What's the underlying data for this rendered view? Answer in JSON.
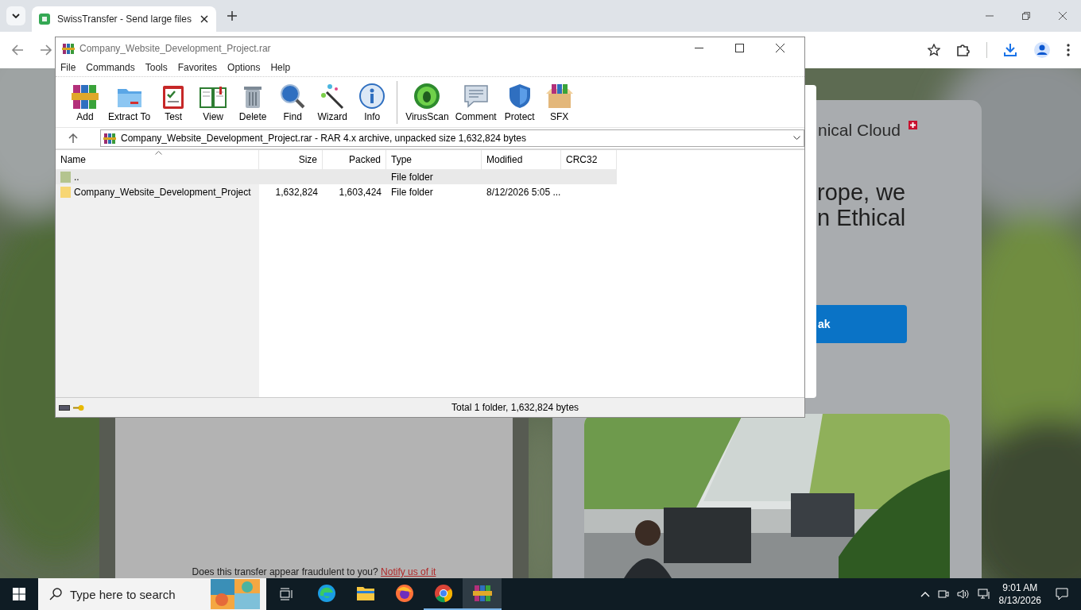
{
  "browser": {
    "tabs": [
      {
        "title": "SwissTransfer - Send large files",
        "selected": true
      }
    ]
  },
  "page": {
    "brand": "nical Cloud",
    "headline": [
      "rope, we",
      "n Ethical"
    ],
    "cta": "ak",
    "report": {
      "text": "Does this transfer appear fraudulent to you?",
      "link": "Notify us of it"
    }
  },
  "winrar": {
    "title": "Company_Website_Development_Project.rar",
    "menu": [
      "File",
      "Commands",
      "Tools",
      "Favorites",
      "Options",
      "Help"
    ],
    "toolbar": [
      {
        "label": "Add"
      },
      {
        "label": "Extract To"
      },
      {
        "label": "Test"
      },
      {
        "label": "View"
      },
      {
        "label": "Delete"
      },
      {
        "label": "Find"
      },
      {
        "label": "Wizard"
      },
      {
        "label": "Info"
      },
      {
        "label": "VirusScan"
      },
      {
        "label": "Comment"
      },
      {
        "label": "Protect"
      },
      {
        "label": "SFX"
      }
    ],
    "path": "Company_Website_Development_Project.rar - RAR 4.x archive, unpacked size 1,632,824 bytes",
    "columns": [
      "Name",
      "Size",
      "Packed",
      "Type",
      "Modified",
      "CRC32"
    ],
    "rows": [
      {
        "kind": "parent",
        "name": "..",
        "type": "File folder",
        "selected": true
      },
      {
        "kind": "folder",
        "name": "Company_Website_Development_Project",
        "size": "1,632,824",
        "packed": "1,603,424",
        "type": "File folder",
        "modified": "8/12/2026 5:05 ...",
        "selected": false
      }
    ],
    "status": "Total 1 folder, 1,632,824 bytes"
  },
  "taskbar": {
    "search_placeholder": "Type here to search",
    "apps": [
      {
        "running": false,
        "selected": false
      },
      {
        "running": false,
        "selected": false
      },
      {
        "running": false,
        "selected": false
      },
      {
        "running": true,
        "selected": false
      },
      {
        "running": true,
        "selected": true
      }
    ],
    "time": "9:01 AM",
    "date": "8/13/2026"
  }
}
